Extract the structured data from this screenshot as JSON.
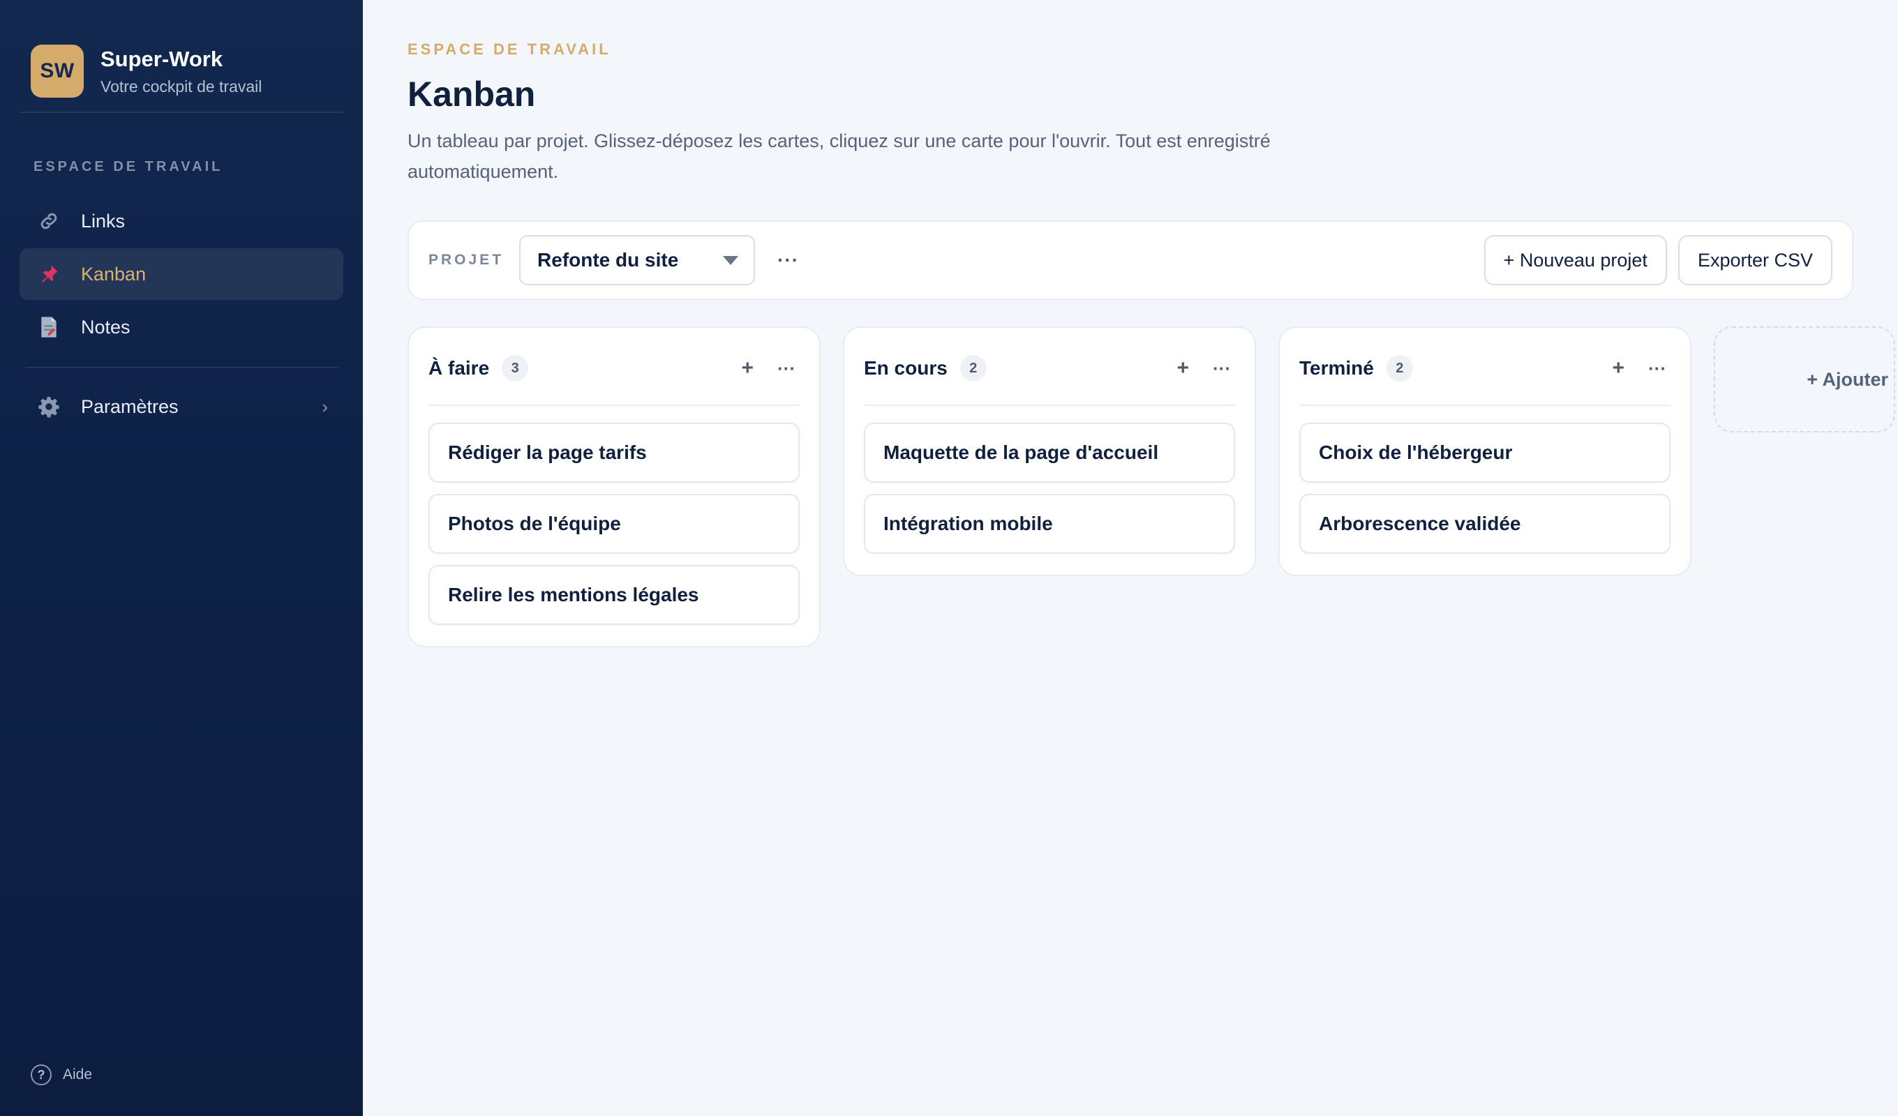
{
  "sidebar": {
    "brand": {
      "logo": "SW",
      "name": "Super-Work",
      "tagline": "Votre cockpit de travail"
    },
    "section_label": "ESPACE DE TRAVAIL",
    "items": [
      {
        "label": "Links",
        "icon": "link-icon",
        "active": false
      },
      {
        "label": "Kanban",
        "icon": "pushpin-icon",
        "active": true
      },
      {
        "label": "Notes",
        "icon": "notes-icon",
        "active": false
      }
    ],
    "settings": {
      "label": "Paramètres",
      "icon": "gear-icon",
      "chevron": "›"
    },
    "help": {
      "label": "Aide",
      "icon_glyph": "?"
    }
  },
  "page": {
    "eyebrow": "ESPACE DE TRAVAIL",
    "title": "Kanban",
    "description": "Un tableau par projet. Glissez-déposez les cartes, cliquez sur une carte pour l'ouvrir. Tout est enregistré automatiquement."
  },
  "toolbar": {
    "project_label": "PROJET",
    "project_selected": "Refonte du site",
    "more": "···",
    "new_project": "+ Nouveau projet",
    "export_csv": "Exporter CSV"
  },
  "board": {
    "columns": [
      {
        "title": "À faire",
        "count": "3",
        "add": "+",
        "more": "···",
        "cards": [
          "Rédiger la page tarifs",
          "Photos de l'équipe",
          "Relire les mentions légales"
        ]
      },
      {
        "title": "En cours",
        "count": "2",
        "add": "+",
        "more": "···",
        "cards": [
          "Maquette de la page d'accueil",
          "Intégration mobile"
        ]
      },
      {
        "title": "Terminé",
        "count": "2",
        "add": "+",
        "more": "···",
        "cards": [
          "Choix de l'hébergeur",
          "Arborescence validée"
        ]
      }
    ],
    "add_column": "+ Ajouter"
  },
  "colors": {
    "sidebar_bg": "#0e2147",
    "accent_gold": "#d4ab6a",
    "page_bg": "#f3f6fb",
    "text_dark": "#10203d"
  }
}
